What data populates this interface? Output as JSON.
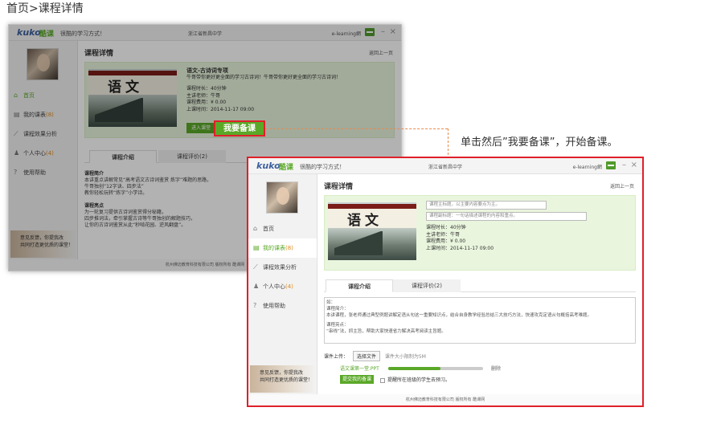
{
  "breadcrumb": "首页>课程详情",
  "annotation": "单击然后”我要备课”，开始备课。",
  "app": {
    "logo_text": "kuko",
    "logo_cn": "酷课",
    "slogan": "很酷的学习方式！",
    "school": "浙江省新昌中学",
    "user": "e-learning網",
    "min_glyph": "–",
    "close_glyph": "×",
    "footer": "杭州佛迈教育科技有限公司  版权所有  酷课网"
  },
  "sidebar": {
    "items": [
      {
        "label": "首页",
        "icon": "home-icon",
        "glyph": "⌂",
        "count": ""
      },
      {
        "label": "我的课表",
        "icon": "schedule-icon",
        "glyph": "▤",
        "count": "(8)"
      },
      {
        "label": "课程效果分析",
        "icon": "chart-icon",
        "glyph": "⟋",
        "count": ""
      },
      {
        "label": "个人中心",
        "icon": "person-icon",
        "glyph": "♟",
        "count": "(4)"
      },
      {
        "label": "使用帮助",
        "icon": "help-icon",
        "glyph": "?",
        "count": ""
      }
    ],
    "promo_line1": "意见反馈，你提我改",
    "promo_line2": "共同打造更优质的课堂！"
  },
  "bg_page": {
    "title": "课程详情",
    "back": "返回上一页",
    "course_title": "语文-古诗词专项",
    "course_desc": "牛哥带你更好更全面的学习古诗词！牛哥带你更好更全面的学习古诗词！",
    "duration": "课程时长：40分钟",
    "teacher": "主讲老师：牛哥",
    "fee": "课程费用：¥ 0.00",
    "time": "上课时间：2014-11-17 09:00",
    "enter_btn": "进入课堂",
    "prepare_btn": "我要备课",
    "tab_intro": "课程介绍",
    "tab_review": "课程评价(2)",
    "intro_h1": "课程简介",
    "intro_p1": "本讲重点讲解常见“高考语文古诗词鉴赏 炼字”难题的思路，",
    "intro_p2": "牛哥独创“12字诀、四步法”",
    "intro_p3": "教你轻松玩转“炼字”小学诗。",
    "intro_h2": "课程亮点",
    "intro_p4": "为一轮复习提供古诗词鉴赏得分秘籍，",
    "intro_p5": "四步推词法，牵引掌握古诗等牛哥独创的解题技巧，",
    "intro_p6": "让你的古诗词鉴赏从此“秒啃花园、逆风翻盘”。"
  },
  "fg_page": {
    "title": "课程详情",
    "back": "返回上一页",
    "main_title_placeholder": "课程主标题，以主要内容要点为主。",
    "sub_title_placeholder": "课程副标题：一句话描述课程的内容和重点。",
    "duration": "课程时长：40分钟",
    "teacher": "主讲老师：牛哥",
    "fee": "课程费用：¥ 0.00",
    "time": "上课时间：2014-11-17 09:00",
    "tab_intro": "课程介绍",
    "tab_review": "课程评价(2)",
    "box_l1": "如：",
    "box_l2": "课程简介：",
    "box_l3": "本讲课程，张老师通过典型例题讲解定语从句这一重要知识点，结合自身教学经验总结三大技巧方法，快速攻克定语从句概括高考难题。",
    "box_l4": "课程亮点：",
    "box_l5": "“串线”法，抓主旨，帮助大家快速省力解决高考阅读主旨题。",
    "upload_label": "课件上传：",
    "choose_file": "选择文件",
    "size_hint": "课件大小限制为5M",
    "file_name": "语文课第一堂.PPT",
    "upload_progress": 0.55,
    "delete": "删除",
    "submit_btn": "提交我的备课",
    "remind": "提醒所在班级的学生去预习。"
  },
  "cover": {
    "chars": "语文"
  },
  "colors": {
    "brand_green": "#5aa828",
    "highlight_red": "#e0202a",
    "panel_green": "#e9f5dd"
  }
}
